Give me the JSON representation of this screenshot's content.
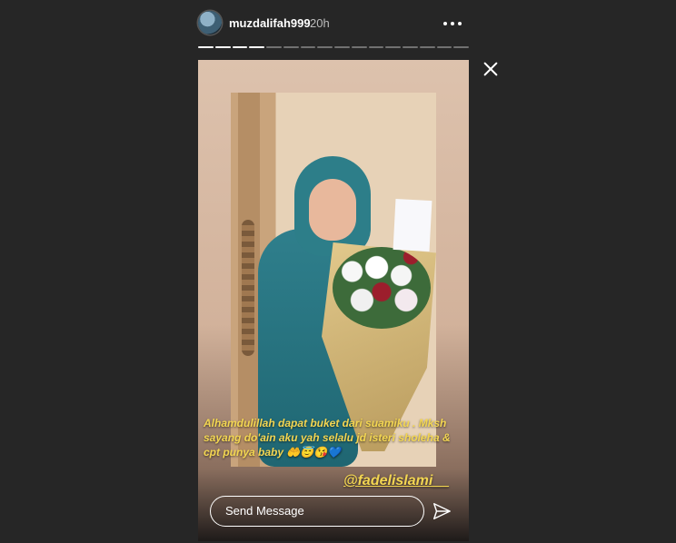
{
  "header": {
    "username": "muzdalifah999",
    "time": "20h",
    "progress_total": 16,
    "progress_done": 4
  },
  "icons": [
    "more-icon",
    "close-icon",
    "send-icon",
    "avatar"
  ],
  "story": {
    "caption": "Alhamdulillah dapat buket dari suamiku . Mksh sayang do'ain aku yah selalu jd isteri sholeha & cpt punya baby 🤲😇😘💙",
    "mention": "@fadelislami__"
  },
  "reply": {
    "placeholder": "Send Message"
  },
  "colors": {
    "background": "#262626",
    "caption_text": "#f3d652",
    "progress_done": "#ffffff"
  }
}
